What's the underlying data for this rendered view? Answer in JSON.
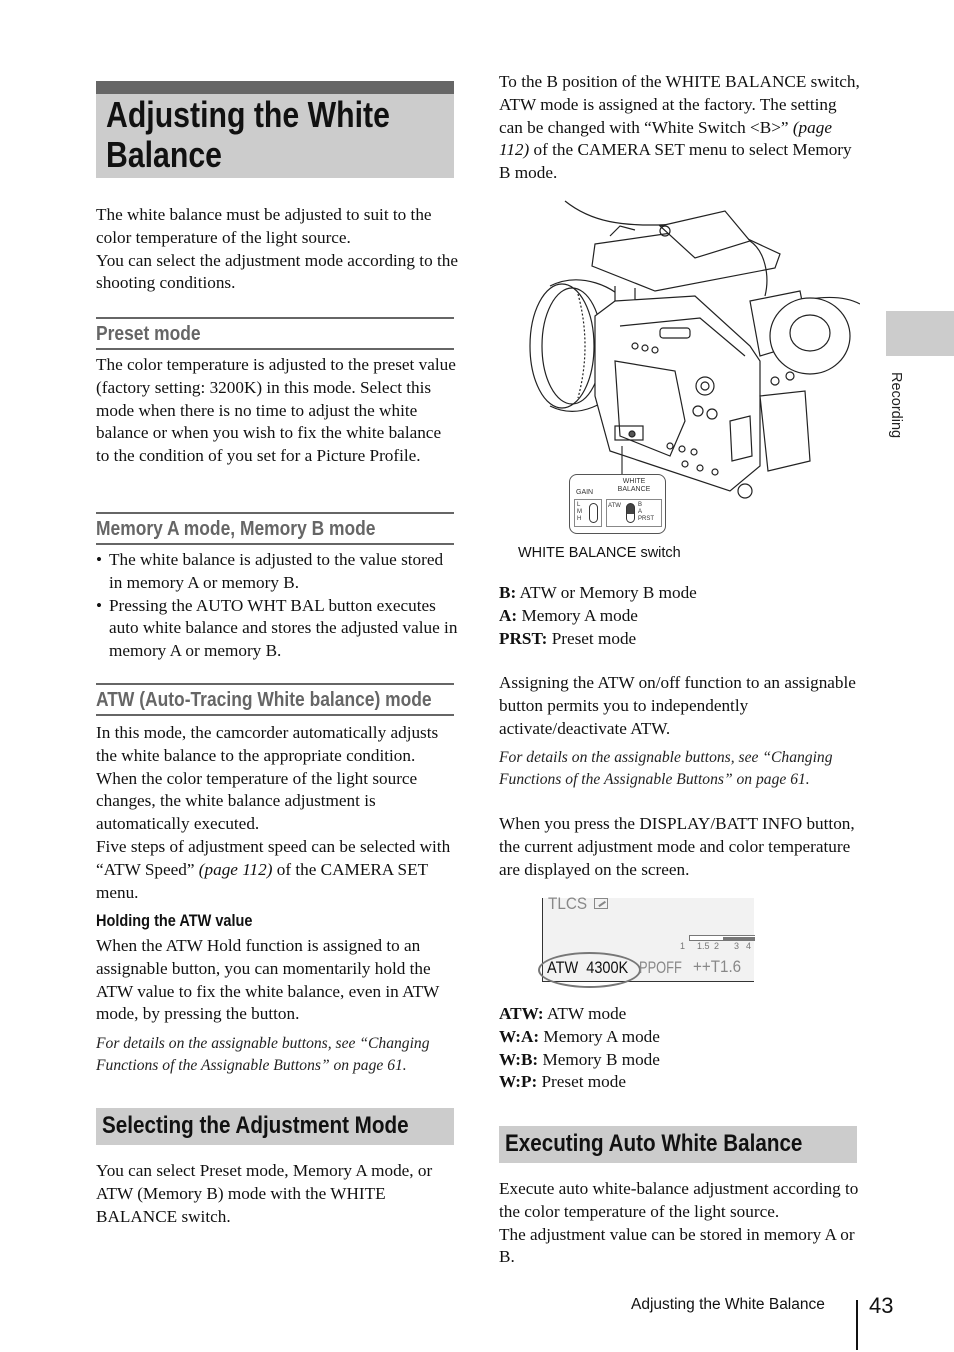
{
  "page": {
    "title": "Adjusting the White Balance",
    "side_tab_label": "Recording",
    "footer_label": "Adjusting the White Balance",
    "page_number": "43"
  },
  "left": {
    "intro": [
      "The white balance must be adjusted to suit to the color temperature of the light source.",
      "You can select the adjustment mode according to the shooting conditions."
    ],
    "preset": {
      "heading": "Preset mode",
      "text": "The color temperature is adjusted to the preset value (factory setting: 3200K) in this mode. Select this mode when there is no time to adjust the white balance or when you wish to fix the white balance to the condition of you set for a Picture Profile."
    },
    "memory": {
      "heading": "Memory A mode, Memory B mode",
      "bullets": [
        "The white balance is adjusted to the value stored in memory A or memory B.",
        "Pressing the AUTO WHT BAL button executes auto white balance and stores the adjusted value in memory A or memory B."
      ]
    },
    "atw": {
      "heading": "ATW (Auto-Tracing White balance) mode",
      "text1": "In this mode, the camcorder automatically adjusts the white balance to the appropriate condition. When the color temperature of the light source changes, the white balance adjustment is automatically executed.",
      "text2_pre": "Five steps of adjustment speed can be selected with “ATW Speed” ",
      "text2_ref": "(page 112)",
      "text2_post": " of the CAMERA SET menu.",
      "hold_heading": "Holding the ATW value",
      "hold_text": "When the ATW Hold function is assigned to an assignable button, you can momentarily hold the ATW value to fix the white balance, even in ATW mode, by pressing the button.",
      "note": "For details on the assignable buttons, see “Changing Functions of the Assignable Buttons” on page 61."
    },
    "selecting": {
      "heading": "Selecting the Adjustment Mode",
      "text": "You can select Preset mode, Memory A mode, or ATW (Memory B) mode with the WHITE BALANCE switch."
    }
  },
  "right": {
    "intro_pre": "To the B position of the WHITE BALANCE switch, ATW mode is assigned at the factory. The setting can be changed with “White Switch <B>” ",
    "intro_ref": "(page 112)",
    "intro_post": " of the CAMERA SET menu to select Memory B mode.",
    "figure": {
      "panel_gain": "GAIN",
      "panel_wb_line1": "WHITE",
      "panel_wb_line2": "BALANCE",
      "gain_positions": [
        "L",
        "M",
        "H"
      ],
      "wb_left": "ATW",
      "wb_positions": [
        "B",
        "A",
        "PRST"
      ],
      "caption": "WHITE BALANCE switch"
    },
    "switch_legend": [
      {
        "key": "B:",
        "desc": " ATW or Memory B mode"
      },
      {
        "key": "A:",
        "desc": " Memory A mode"
      },
      {
        "key": "PRST:",
        "desc": " Preset mode"
      }
    ],
    "assign_text": "Assigning the ATW on/off function to an assignable button permits you to independently activate/deactivate ATW.",
    "assign_note": "For details on the assignable buttons, see “Changing Functions of the Assignable Buttons” on page 61.",
    "display_text": "When you press the DISPLAY/BATT INFO button, the current adjustment mode and color temperature are displayed on the screen.",
    "lcd": {
      "tlcs": "TLCS",
      "ticks": [
        "1",
        "1.5",
        "2",
        "3",
        "4"
      ],
      "bar_fill_fraction": 0.5,
      "wb_mode": "ATW",
      "color_temp": "4300K",
      "pp": "PPOFF",
      "iris": "++T1.6"
    },
    "display_legend": [
      {
        "key": "ATW:",
        "desc": " ATW mode"
      },
      {
        "key": "W:A:",
        "desc": " Memory A mode"
      },
      {
        "key": "W:B:",
        "desc": " Memory B mode"
      },
      {
        "key": "W:P:",
        "desc": " Preset mode"
      }
    ],
    "executing": {
      "heading": "Executing Auto White Balance",
      "text1": "Execute auto white-balance adjustment according to the color temperature of the light source.",
      "text2": "The adjustment value can be stored in memory A or B."
    }
  }
}
